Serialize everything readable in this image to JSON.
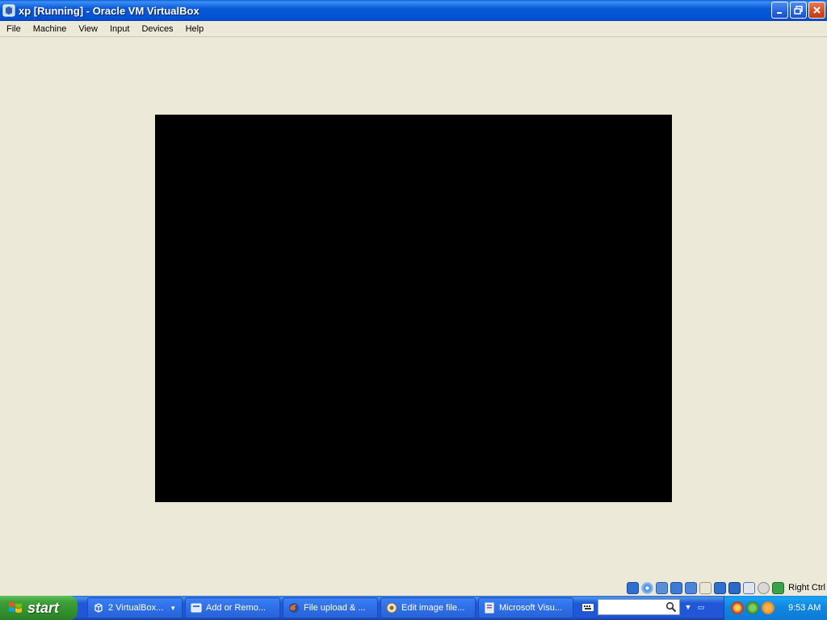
{
  "window": {
    "title": "xp [Running] - Oracle VM VirtualBox",
    "icon": "virtualbox-icon"
  },
  "menubar": {
    "items": [
      "File",
      "Machine",
      "View",
      "Input",
      "Devices",
      "Help"
    ]
  },
  "vm": {
    "screen_color": "#000000"
  },
  "statusbar": {
    "icons": [
      "hard-disk-icon",
      "optical-drive-icon",
      "audio-icon",
      "network-icon",
      "usb-icon",
      "shared-folders-icon",
      "display-icon",
      "video-capture-icon",
      "virtualization-icon",
      "mouse-integration-icon",
      "keyboard-capture-icon"
    ],
    "host_key": "Right Ctrl"
  },
  "taskbar": {
    "start_label": "start",
    "tasks": [
      {
        "label": "2 VirtualBox...",
        "icon": "virtualbox-icon",
        "group": true
      },
      {
        "label": "Add or Remo...",
        "icon": "add-remove-programs-icon"
      },
      {
        "label": "File upload & ...",
        "icon": "firefox-icon"
      },
      {
        "label": "Edit image file...",
        "icon": "gimp-icon"
      },
      {
        "label": "Microsoft Visu...",
        "icon": "visual-studio-icon"
      }
    ],
    "clock": "9:53 AM"
  }
}
